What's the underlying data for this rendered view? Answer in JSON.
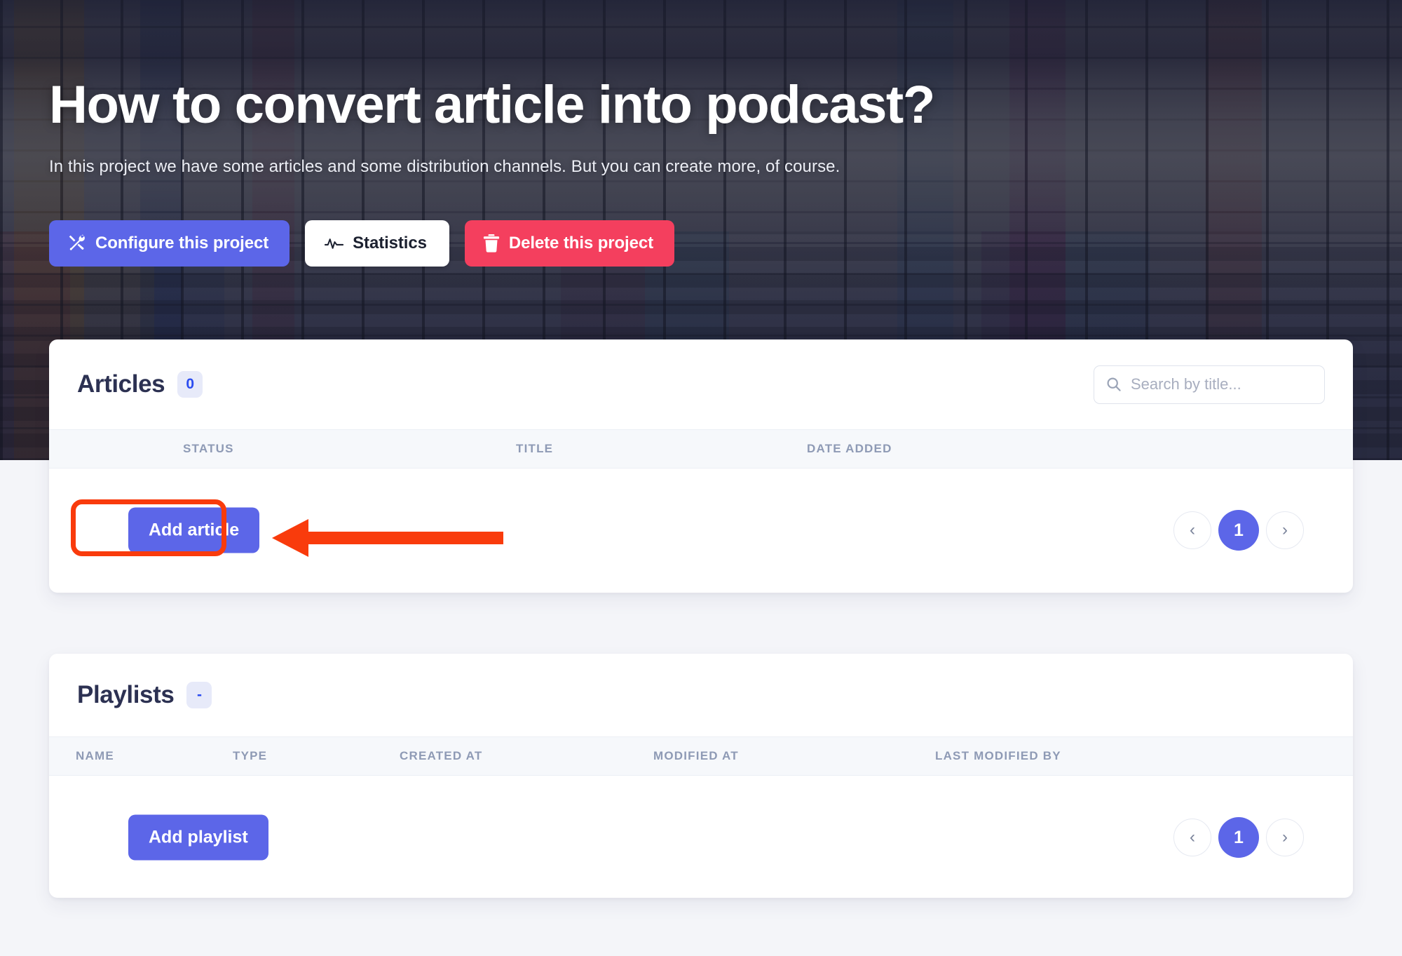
{
  "hero": {
    "title": "How to convert article into podcast?",
    "subtitle": "In this project we have some articles and some distribution channels. But you can create more, of course.",
    "actions": {
      "configure_label": "Configure this project",
      "statistics_label": "Statistics",
      "delete_label": "Delete this project"
    }
  },
  "articles": {
    "title": "Articles",
    "count": "0",
    "search": {
      "placeholder": "Search by title...",
      "value": ""
    },
    "columns": [
      "STATUS",
      "TITLE",
      "DATE ADDED"
    ],
    "rows": [],
    "add_label": "Add article",
    "pagination": {
      "prev": "‹",
      "current": "1",
      "next": "›"
    }
  },
  "playlists": {
    "title": "Playlists",
    "count": "-",
    "columns": [
      "NAME",
      "TYPE",
      "CREATED AT",
      "MODIFIED AT",
      "LAST MODIFIED BY"
    ],
    "rows": [],
    "add_label": "Add playlist",
    "pagination": {
      "prev": "‹",
      "current": "1",
      "next": "›"
    }
  },
  "annotation": {
    "highlight_color": "#f93b0c",
    "target": "add-article-button"
  },
  "colors": {
    "primary": "#5c66e8",
    "danger": "#f43f5e",
    "badge_text": "#2b4cf0",
    "badge_bg": "#e7eaf9",
    "page_bg": "#f4f5f9",
    "heading": "#2c3152",
    "muted": "#8e9ab5"
  }
}
